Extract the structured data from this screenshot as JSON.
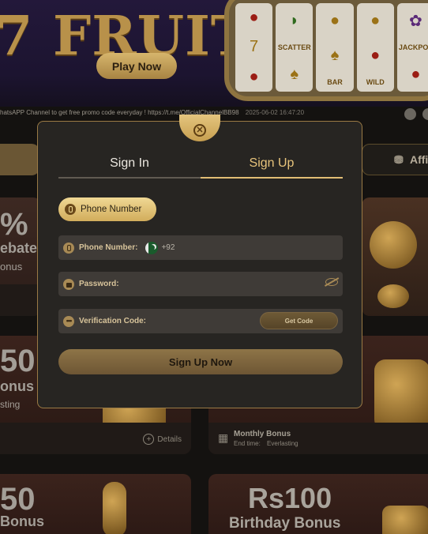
{
  "banner": {
    "title": "7 FRUIT",
    "play_button": "Play Now",
    "reel_labels": [
      "SCATTER",
      "BAR",
      "WILD",
      "JACKPOT"
    ]
  },
  "ticker": {
    "text": "hatsAPP Channel to get free promo code everyday ! https://t.me/OfficialChannelBB98",
    "timestamp": "2025-06-02 16:47:20"
  },
  "nav": {
    "right_tab": "Affi"
  },
  "promos": [
    {
      "headline": "%",
      "line2": "ebates",
      "line3": "onus"
    },
    {
      "headline": "50",
      "line2": "onus",
      "line3": "sting",
      "details": "Details"
    },
    {
      "title": "Monthly Bonus",
      "end_label": "End time:",
      "end_value": "Everlasting"
    },
    {
      "headline": "50",
      "line2": "Bonus"
    },
    {
      "headline": "Rs100",
      "line2": "Birthday Bonus"
    }
  ],
  "modal": {
    "tabs": [
      {
        "label": "Sign In",
        "active": false
      },
      {
        "label": "Sign Up",
        "active": true
      }
    ],
    "method_pill": "Phone Number",
    "fields": {
      "phone_label": "Phone Number:",
      "country_code": "+92",
      "password_label": "Password:",
      "code_label": "Verification Code:",
      "get_code": "Get Code"
    },
    "submit": "Sign Up Now"
  },
  "colors": {
    "accent_gold": "#e1bd75",
    "modal_bg": "#272522",
    "field_bg": "#3f3b37"
  }
}
